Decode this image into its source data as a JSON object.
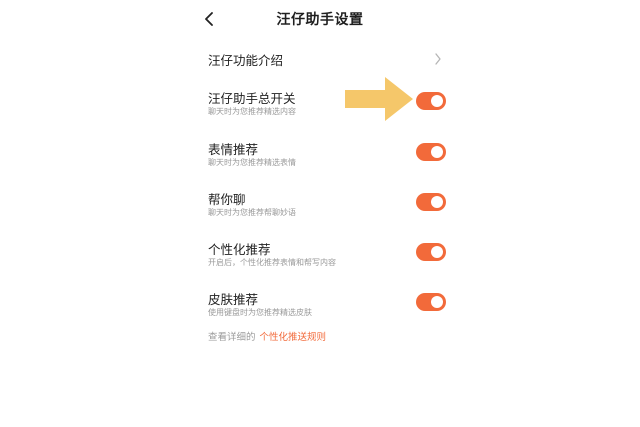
{
  "header": {
    "title": "汪仔助手设置"
  },
  "intro": {
    "label": "汪仔功能介绍"
  },
  "settings": [
    {
      "title": "汪仔助手总开关",
      "desc": "聊天时为您推荐精选内容",
      "enabled": true
    },
    {
      "title": "表情推荐",
      "desc": "聊天时为您推荐精选表情",
      "enabled": true
    },
    {
      "title": "帮你聊",
      "desc": "聊天时为您推荐帮聊妙语",
      "enabled": true
    },
    {
      "title": "个性化推荐",
      "desc": "开启后，个性化推荐表情和帮写内容",
      "enabled": true
    },
    {
      "title": "皮肤推荐",
      "desc": "使用键盘时为您推荐精选皮肤",
      "enabled": true
    }
  ],
  "footer": {
    "prefix": "查看详细的",
    "link": "个性化推送规则"
  },
  "colors": {
    "accent": "#f26a3a",
    "arrow": "#f5c76a",
    "muted": "#9a9a9a"
  },
  "icons": {
    "back": "chevron-left-icon",
    "intro_chevron": "chevron-right-icon",
    "annotation": "arrow-right-icon"
  }
}
